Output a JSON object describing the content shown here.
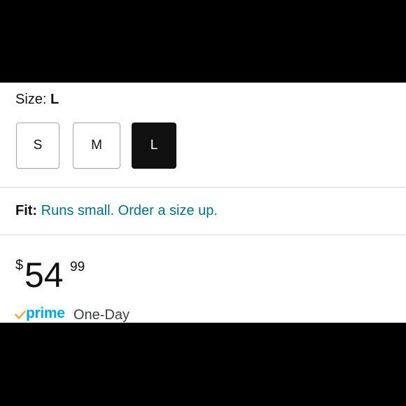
{
  "size": {
    "label": "Size:",
    "selected": "L",
    "options": [
      "S",
      "M",
      "L"
    ]
  },
  "fit": {
    "label": "Fit:",
    "text": "Runs small. Order a size up."
  },
  "price": {
    "symbol": "$",
    "whole": "54",
    "fraction": "99"
  },
  "delivery": {
    "prime_label": "prime",
    "speed": "One-Day",
    "icon": "prime-check-icon"
  },
  "colors": {
    "selected_swatch": "#111111",
    "link_teal": "#007185",
    "prime_blue": "#00a8e1",
    "prime_check": "#f3a847",
    "divider": "#d5d9d9"
  }
}
